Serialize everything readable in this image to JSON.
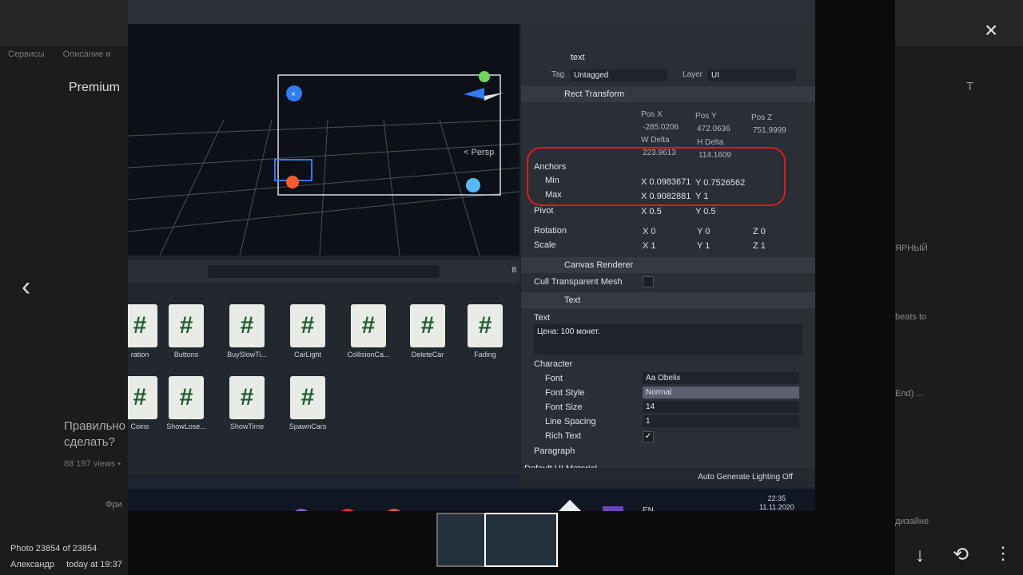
{
  "browser": {
    "bookmarks": "Сервисы",
    "bookmark2": "Описание и"
  },
  "youtube": {
    "brand": "Premium",
    "title_line1": "Правильно",
    "title_line2": "сделать?",
    "views": "88 197 views •",
    "author_prefix": "Фри"
  },
  "unity": {
    "scene_label": "< Persp",
    "inspector": {
      "object_name": "text",
      "tag_label": "Tag",
      "tag_value": "Untagged",
      "layer_label": "Layer",
      "layer_value": "UI",
      "rect_transform": "Rect Transform",
      "pos_x_label": "Pos X",
      "pos_y_label": "Pos Y",
      "pos_z_label": "Pos Z",
      "pos_x": "-285.0206",
      "pos_y": "472.0636",
      "pos_z": "751.9999",
      "w_delta_label": "W Delta",
      "h_delta_label": "H Delta",
      "w_delta": "223.9613",
      "h_delta": "114.1609",
      "anchors": "Anchors",
      "min_label": "Min",
      "max_label": "Max",
      "min_x": "X 0.0983671",
      "min_y": "Y 0.7526562",
      "max_x": "X 0.9082881",
      "max_y": "Y 1",
      "pivot_label": "Pivot",
      "pivot_x": "X 0.5",
      "pivot_y": "Y 0.5",
      "rotation_label": "Rotation",
      "rotation_x": "X 0",
      "rotation_y": "Y 0",
      "rotation_z": "Z 0",
      "scale_label": "Scale",
      "scale_x": "X 1",
      "scale_y": "Y 1",
      "scale_z": "Z 1",
      "canvas_renderer": "Canvas Renderer",
      "cull_transparent_mesh": "Cull Transparent Mesh",
      "text_component": "Text",
      "text_label": "Text",
      "text_value": "Цена: 100 монет.",
      "character": "Character",
      "font_label": "Font",
      "font_value": "Aa Obelix",
      "font_style_label": "Font Style",
      "font_style_value": "Normal",
      "font_size_label": "Font Size",
      "font_size_value": "14",
      "line_spacing_label": "Line Spacing",
      "line_spacing_value": "1",
      "rich_text_label": "Rich Text",
      "paragraph": "Paragraph",
      "default_ui_material": "Default UI Material"
    },
    "project": {
      "search_count": "8",
      "assets": [
        "ration",
        "Buttons",
        "BuySlowTi...",
        "CarLight",
        "CollisionCa...",
        "DeleteCar",
        "Fading",
        "Coins",
        "ShowLose...",
        "ShowTime",
        "SpawnCars"
      ]
    },
    "status": "Auto Generate Lighting Off"
  },
  "taskbar": {
    "lang": "EN",
    "time": "22:35",
    "date": "11.11.2020"
  },
  "photo_viewer": {
    "counter": "Photo 23854 of 23854",
    "author": "Александр",
    "time": "today at 19:37"
  },
  "right_column": {
    "text1": "beats to",
    "text2": "End) ...",
    "text3": "дизайне",
    "text4": "ЯРНЫЙ",
    "text5": "Т"
  },
  "colors": {
    "accent_red": "#e01a1a",
    "unity_blue": "#2f7cf6",
    "panel": "#2a2e35"
  }
}
